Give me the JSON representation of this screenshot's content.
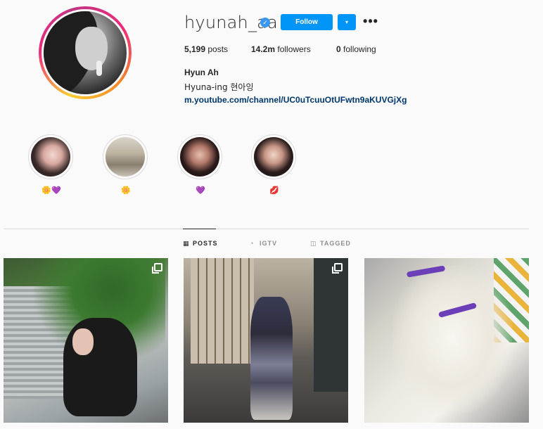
{
  "profile": {
    "username": "hyunah_aa",
    "verified_symbol": "✓",
    "follow_label": "Follow",
    "dropdown_symbol": "▾",
    "more_symbol": "•••",
    "avatar_icon": "profile-photo",
    "accent_color": "#0095f6"
  },
  "stats": {
    "posts_count": "5,199",
    "posts_label": "posts",
    "followers_count": "14.2m",
    "followers_label": "followers",
    "following_count": "0",
    "following_label": "following"
  },
  "bio": {
    "full_name": "Hyun Ah",
    "text": "Hyuna-ing 현아잉",
    "link": "m.youtube.com/channel/UC0uTcuuOtUFwtn9aKUVGjXg"
  },
  "highlights": [
    {
      "label": "🌼💜"
    },
    {
      "label": "🌼"
    },
    {
      "label": "💜"
    },
    {
      "label": "💋"
    }
  ],
  "tabs": {
    "posts": {
      "label": "POSTS",
      "icon": "▦",
      "active": true
    },
    "igtv": {
      "label": "IGTV",
      "icon": "◔",
      "active": false
    },
    "tagged": {
      "label": "TAGGED",
      "icon": "◫",
      "active": false
    }
  },
  "posts": [
    {
      "type": "carousel"
    },
    {
      "type": "carousel"
    },
    {
      "type": "single"
    }
  ]
}
